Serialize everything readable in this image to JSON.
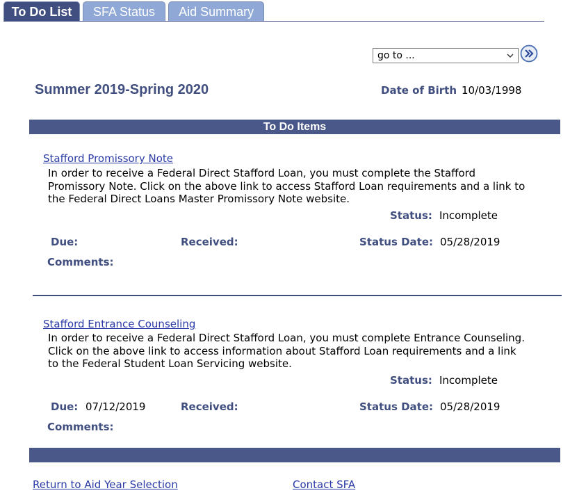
{
  "tabs": [
    {
      "label": "To Do List",
      "active": true
    },
    {
      "label": "SFA Status",
      "active": false
    },
    {
      "label": "Aid Summary",
      "active": false
    }
  ],
  "goto": {
    "selected": "go to ...",
    "go_icon": "double-chevron-right-icon"
  },
  "header": {
    "term": "Summer 2019-Spring 2020",
    "dob_label": "Date of Birth",
    "dob_value": "10/03/1998"
  },
  "section_title": "To Do Items",
  "items": [
    {
      "link": "Stafford Promissory Note",
      "desc": "In order to receive a Federal Direct Stafford Loan, you must complete the Stafford Promissory Note.  Click on the above link to access Stafford Loan requirements and a link to the Federal Direct Loans Master Promissory Note website.",
      "status_label": "Status:",
      "status": "Incomplete",
      "due_label": "Due:",
      "due": "",
      "received_label": "Received:",
      "received": "",
      "status_date_label": "Status Date:",
      "status_date": "05/28/2019",
      "comments_label": "Comments:"
    },
    {
      "link": "Stafford Entrance Counseling",
      "desc": "In order to receive a Federal  Direct Stafford Loan, you must complete  Entrance Counseling.  Click on the above link to access information about Stafford Loan requirements and a link to the Federal Student Loan Servicing website.",
      "status_label": "Status:",
      "status": "Incomplete",
      "due_label": "Due:",
      "due": "07/12/2019",
      "received_label": "Received:",
      "received": "",
      "status_date_label": "Status Date:",
      "status_date": "05/28/2019",
      "comments_label": "Comments:"
    }
  ],
  "footer": {
    "return_link": "Return to Aid Year Selection",
    "contact_link": "Contact SFA"
  },
  "colors": {
    "navy": "#414f80",
    "tab_inactive": "#8fa8d6",
    "link": "#2a3aa6"
  }
}
